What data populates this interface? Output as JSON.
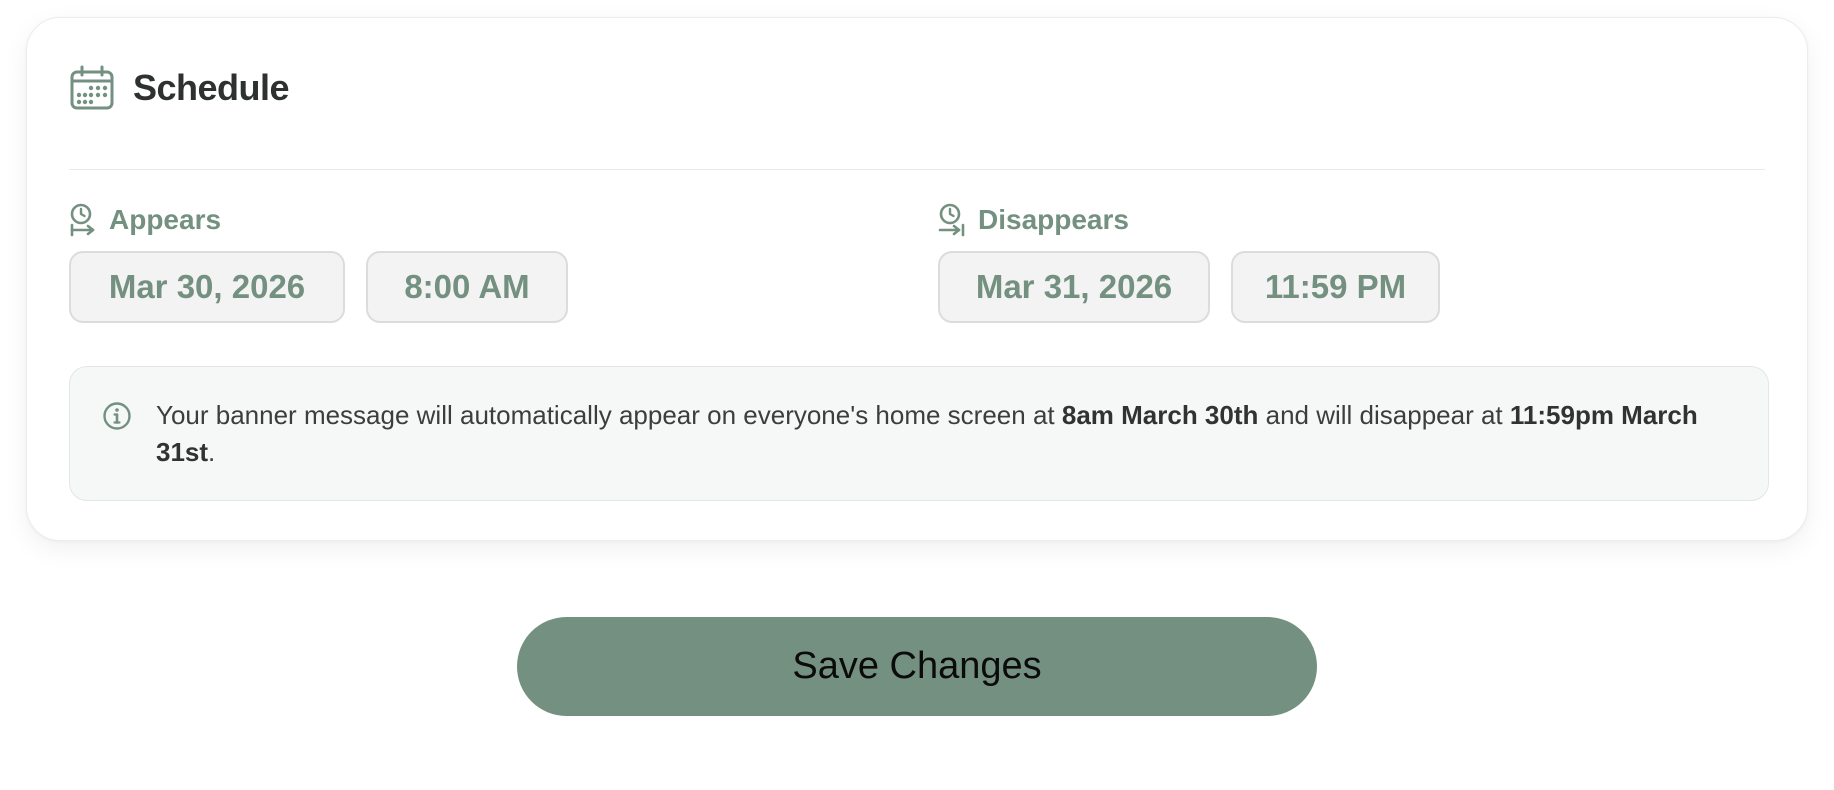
{
  "colors": {
    "accent": "#739080",
    "heading": "#2d3230",
    "body_text": "#3a3f3d",
    "pill_bg": "#f3f3f3",
    "info_bg": "#f6f8f7",
    "button_bg": "#739080"
  },
  "schedule": {
    "title": "Schedule",
    "title_icon": "calendar-icon",
    "appears": {
      "label": "Appears",
      "icon": "clock-arrow-icon",
      "date": "Mar 30, 2026",
      "time": "8:00 AM"
    },
    "disappears": {
      "label": "Disappears",
      "icon": "clock-arrow-end-icon",
      "date": "Mar 31, 2026",
      "time": "11:59 PM"
    },
    "info": {
      "icon": "info-icon",
      "text_before": "Your banner message will automatically appear on everyone's home screen at ",
      "appear_time": "8am March 30th",
      "text_middle": " and will disappear at ",
      "disappear_time": "11:59pm March 31st",
      "text_after": "."
    }
  },
  "actions": {
    "save_label": "Save Changes"
  }
}
